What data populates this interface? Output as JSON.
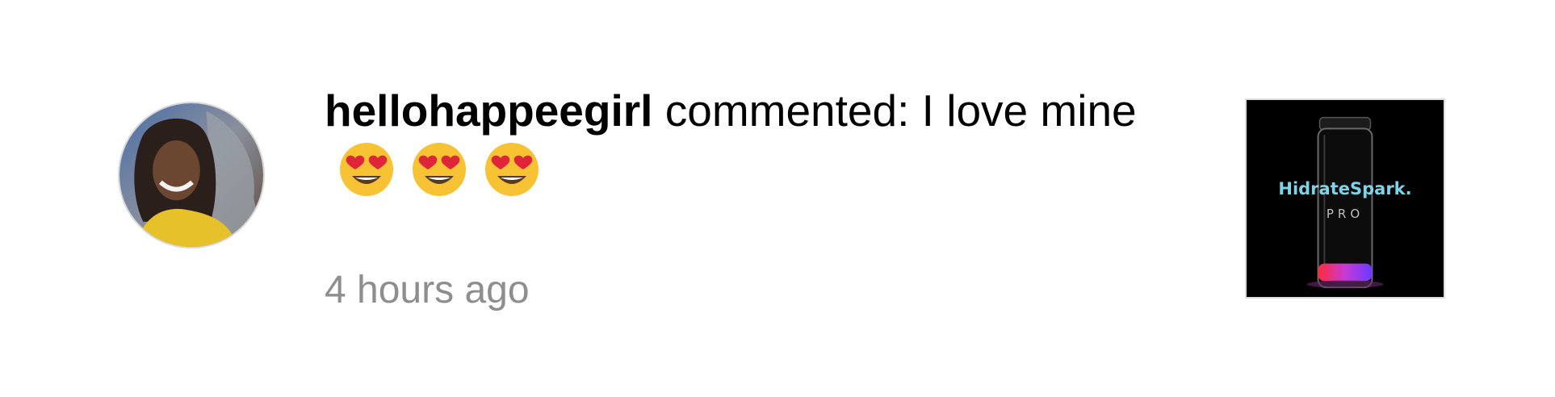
{
  "notification": {
    "username": "hellohappeegirl",
    "action_text": " commented: I love mine",
    "emojis": [
      "heart-eyes-emoji",
      "heart-eyes-emoji",
      "heart-eyes-emoji"
    ],
    "timestamp": "4 hours ago",
    "avatar_icon": "user-avatar-photo",
    "post_thumbnail": {
      "brand": "HidrateSpark.",
      "sub": "PRO"
    }
  },
  "colors": {
    "text": "#000000",
    "timestamp": "#8e8e8e",
    "thumbnail_bg": "#000000",
    "brand": "#7fd3e6"
  }
}
